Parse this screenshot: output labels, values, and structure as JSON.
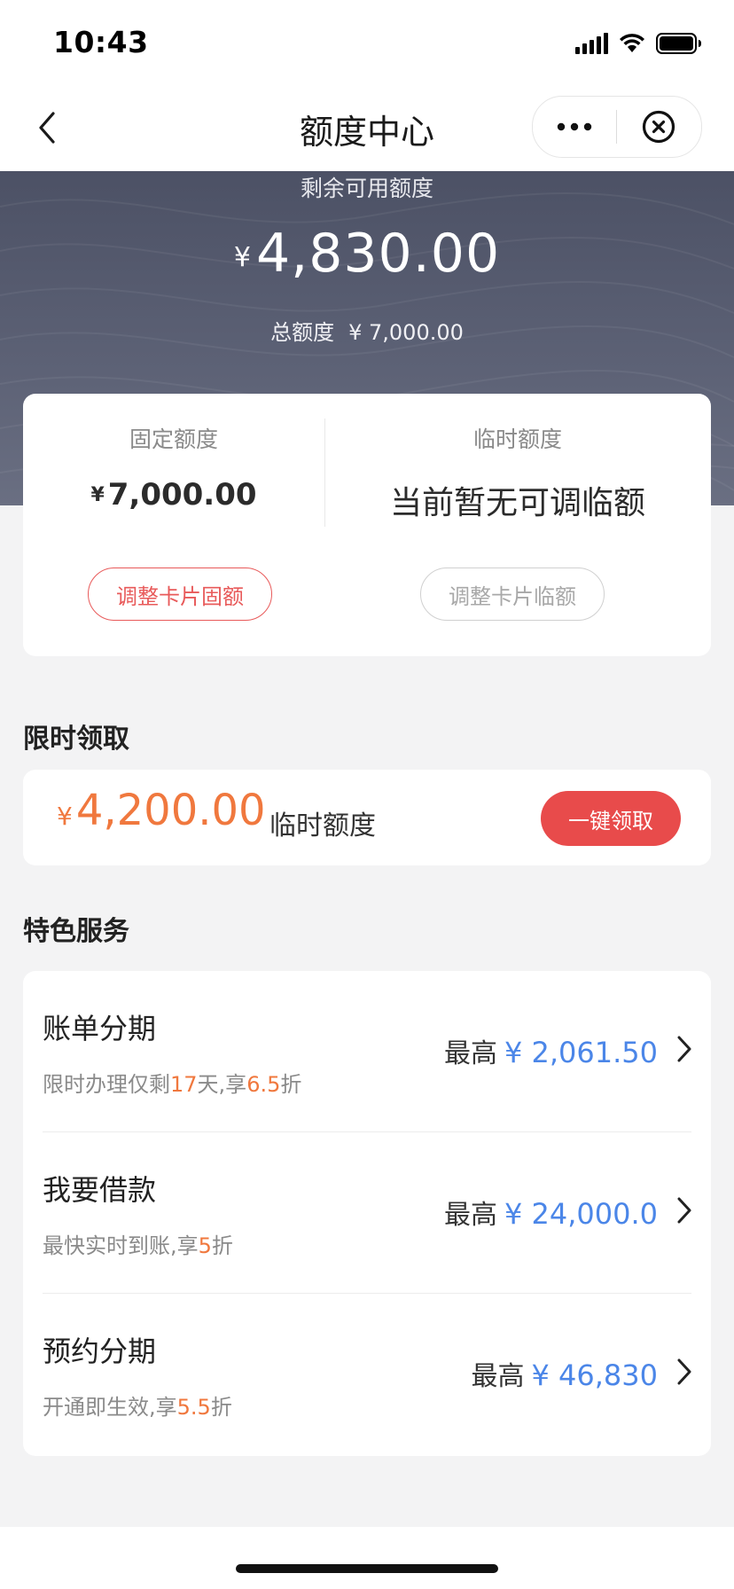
{
  "status_bar": {
    "time": "10:43"
  },
  "nav": {
    "title": "额度中心"
  },
  "hero": {
    "label": "剩余可用额度",
    "currency": "¥",
    "amount": "4,830.00",
    "total_label": "总额度",
    "total_value": "¥ 7,000.00"
  },
  "limits": {
    "fixed": {
      "title": "固定额度",
      "currency": "¥",
      "value": "7,000.00",
      "button": "调整卡片固额"
    },
    "temporary": {
      "title": "临时额度",
      "value": "当前暂无可调临额",
      "button": "调整卡片临额"
    }
  },
  "promo": {
    "section_title": "限时领取",
    "currency": "¥",
    "amount": "4,200.00",
    "label": "临时额度",
    "button": "一键领取"
  },
  "services": {
    "section_title": "特色服务",
    "items": [
      {
        "name": "账单分期",
        "desc_parts": [
          "限时办理仅剩",
          "17",
          "天,享",
          "6.5",
          "折"
        ],
        "right_label": "最高",
        "right_value": "¥ 2,061.50"
      },
      {
        "name": "我要借款",
        "desc_parts": [
          "最快实时到账,享",
          "5",
          "折"
        ],
        "right_label": "最高",
        "right_value": "¥ 24,000.0"
      },
      {
        "name": "预约分期",
        "desc_parts": [
          "开通即生效,享",
          "5.5",
          "折"
        ],
        "right_label": "最高",
        "right_value": "¥ 46,830"
      }
    ]
  },
  "colors": {
    "accent_red": "#e84b4b",
    "accent_orange": "#f0783e",
    "accent_blue": "#4b86e8",
    "hero_bg": "#555a6e"
  },
  "icons": [
    "signal-icon",
    "wifi-icon",
    "battery-icon",
    "back-arrow-icon",
    "more-icon",
    "close-circle-icon",
    "chevron-right-icon"
  ]
}
